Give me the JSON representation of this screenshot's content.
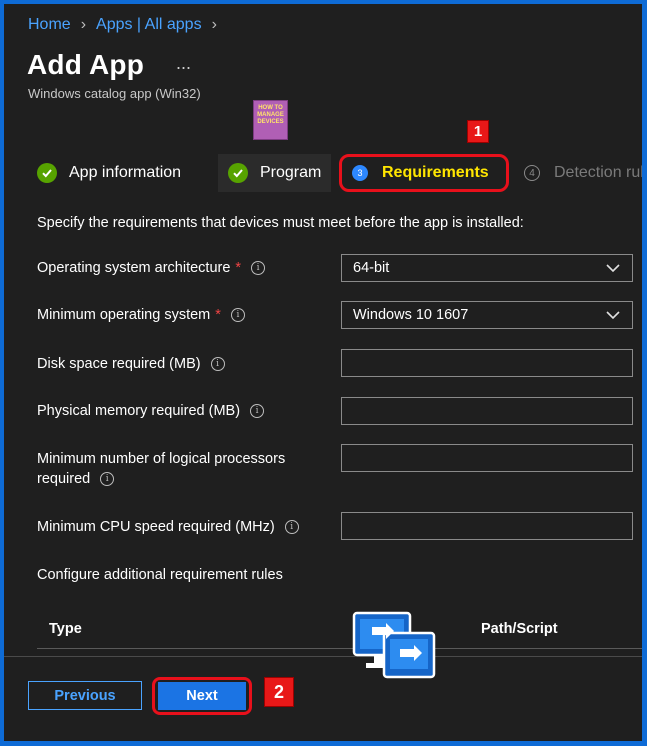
{
  "breadcrumb": {
    "home": "Home",
    "apps": "Apps | All apps"
  },
  "header": {
    "title": "Add App",
    "more": "...",
    "subtitle": "Windows catalog app (Win32)"
  },
  "logo": {
    "line1": "HOW TO",
    "line2": "MANAGE",
    "line3": "DEVICES"
  },
  "annotations": {
    "tab_marker": "1",
    "next_marker": "2"
  },
  "tabs": [
    {
      "label": "App information",
      "status": "complete"
    },
    {
      "label": "Program",
      "status": "complete"
    },
    {
      "step": "3",
      "label": "Requirements",
      "status": "active"
    },
    {
      "step": "4",
      "label": "Detection rules",
      "status": "inactive"
    }
  ],
  "form": {
    "intro": "Specify the requirements that devices must meet before the app is installed:",
    "os_arch": {
      "label": "Operating system architecture",
      "required": "*",
      "value": "64-bit"
    },
    "min_os": {
      "label": "Minimum operating system",
      "required": "*",
      "value": "Windows 10 1607"
    },
    "disk_space": {
      "label": "Disk space required (MB)",
      "value": ""
    },
    "phys_mem": {
      "label": "Physical memory required (MB)",
      "value": ""
    },
    "logical_proc": {
      "label_line1": "Minimum number of logical processors",
      "label_line2": "required",
      "value": ""
    },
    "cpu_speed": {
      "label": "Minimum CPU speed required (MHz)",
      "value": ""
    },
    "additional_rules": "Configure additional requirement rules"
  },
  "table": {
    "col_type": "Type",
    "col_path": "Path/Script"
  },
  "footer": {
    "previous": "Previous",
    "next": "Next"
  },
  "colors": {
    "accent": "#1b74e4",
    "highlight": "#e8101b",
    "active_tab_text": "#ffe600",
    "check": "#57a300"
  },
  "icons": [
    "chevron-right-icon",
    "check-circle-icon",
    "info-icon",
    "chevron-down-icon",
    "remote-desktop-icon"
  ]
}
